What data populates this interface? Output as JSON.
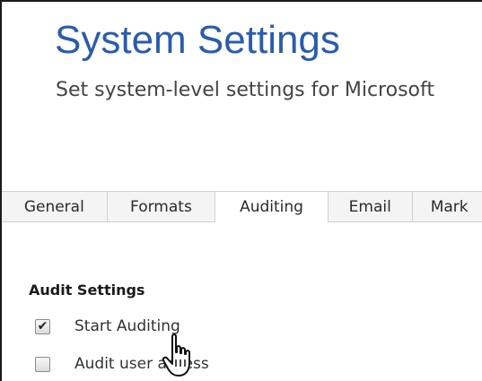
{
  "header": {
    "title": "System Settings",
    "subtitle": "Set system-level settings for Microsoft"
  },
  "tabs": [
    {
      "label": "General",
      "selected": false
    },
    {
      "label": "Formats",
      "selected": false
    },
    {
      "label": "Auditing",
      "selected": true
    },
    {
      "label": "Email",
      "selected": false
    },
    {
      "label": "Mark",
      "selected": false
    }
  ],
  "audit_section": {
    "heading": "Audit Settings",
    "options": [
      {
        "label": "Start Auditing",
        "checked": true
      },
      {
        "label": "Audit user access",
        "checked": false
      }
    ]
  },
  "colors": {
    "title": "#2a5cae",
    "tab_strip": "#f4f4f4"
  },
  "icons": {
    "cursor": "hand-pointer-icon",
    "check": "checkmark-icon"
  }
}
